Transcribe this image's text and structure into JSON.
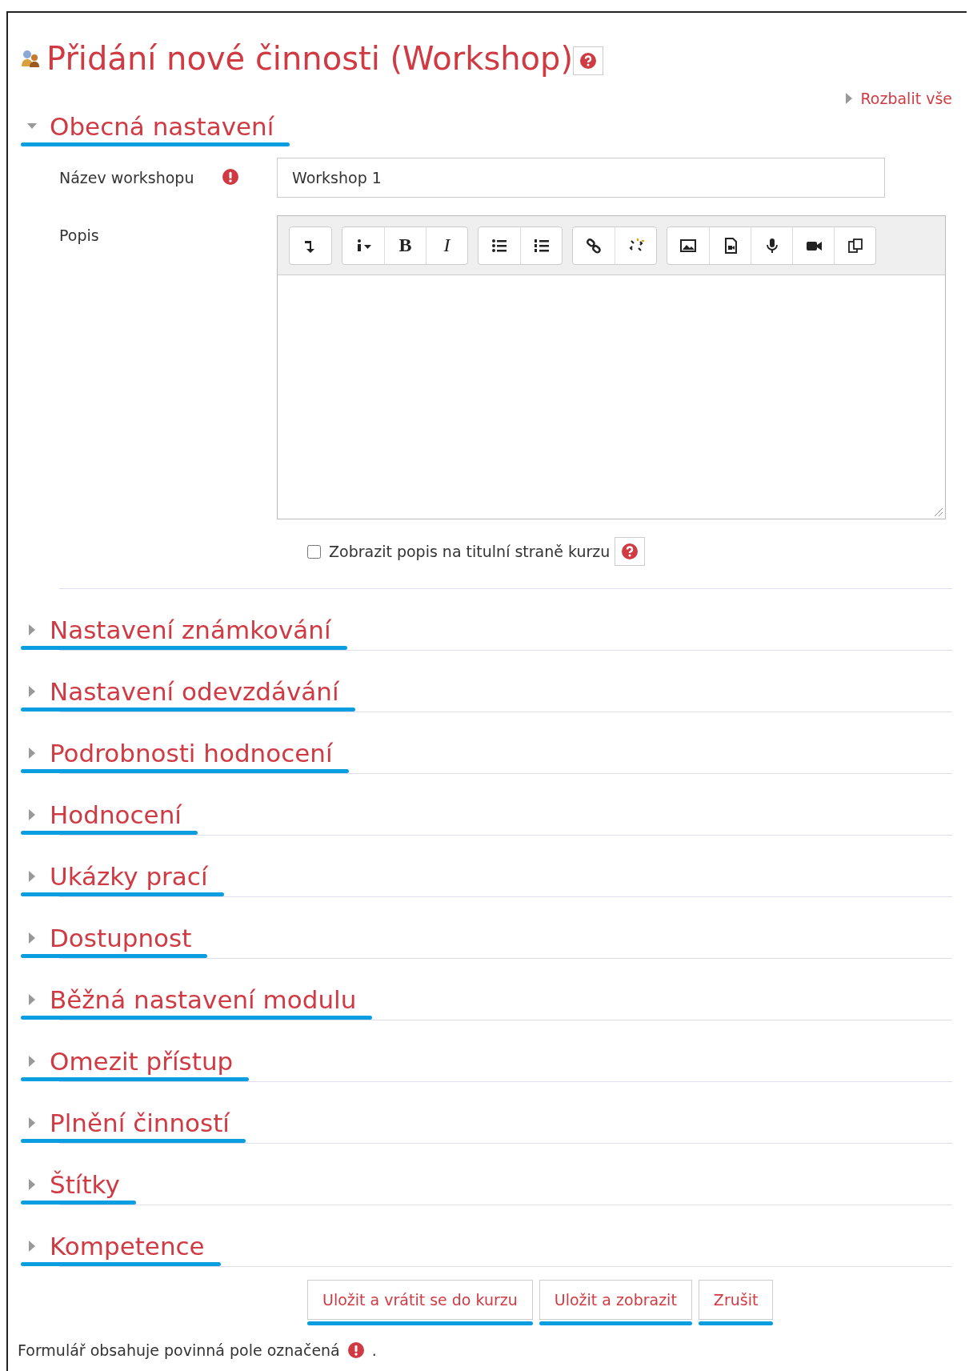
{
  "title": "Přidání nové činnosti (Workshop)",
  "expand_all": "Rozbalit vše",
  "general": {
    "label": "Obecná nastavení",
    "expanded": true
  },
  "name_field": {
    "label": "Název workshopu",
    "required": true,
    "value": "Workshop 1"
  },
  "description": {
    "label": "Popis",
    "bold_glyph": "B",
    "italic_glyph": "I"
  },
  "show_description": {
    "label": "Zobrazit popis na titulní straně kurzu",
    "checked": false
  },
  "sections": [
    {
      "label": "Nastavení známkování",
      "expanded": false
    },
    {
      "label": "Nastavení odevzdávání",
      "expanded": false
    },
    {
      "label": "Podrobnosti hodnocení",
      "expanded": false
    },
    {
      "label": "Hodnocení",
      "expanded": false
    },
    {
      "label": "Ukázky prací",
      "expanded": false
    },
    {
      "label": "Dostupnost",
      "expanded": false
    },
    {
      "label": "Běžná nastavení modulu",
      "expanded": false
    },
    {
      "label": "Omezit přístup",
      "expanded": false
    },
    {
      "label": "Plnění činností",
      "expanded": false
    },
    {
      "label": "Štítky",
      "expanded": false
    },
    {
      "label": "Kompetence",
      "expanded": false
    }
  ],
  "buttons": [
    "Uložit a vrátit se do kurzu",
    "Uložit a zobrazit",
    "Zrušit"
  ],
  "footer": "Formulář obsahuje povinná pole označená",
  "footer_end": "."
}
